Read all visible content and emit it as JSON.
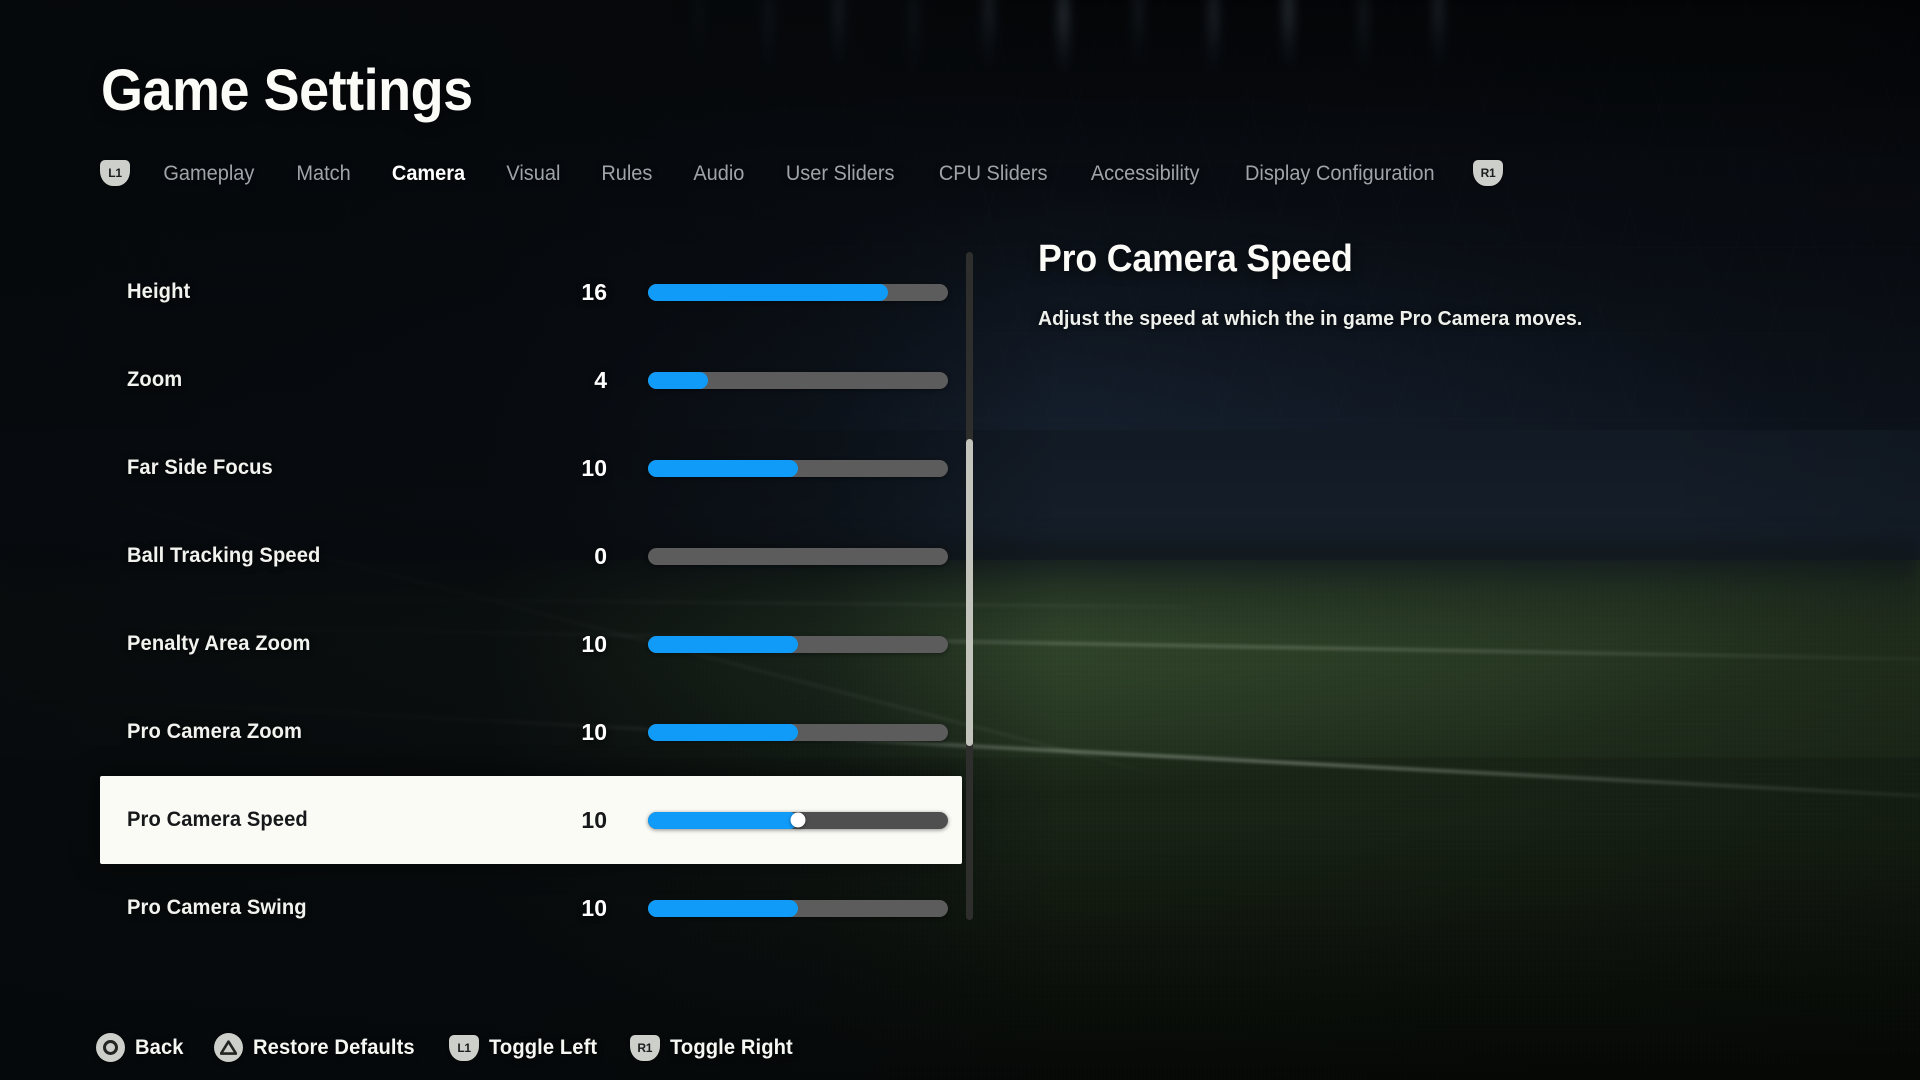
{
  "header": {
    "title": "Game Settings"
  },
  "tabs": {
    "left_bumper": "L1",
    "right_bumper": "R1",
    "items": [
      {
        "label": "Gameplay",
        "active": false
      },
      {
        "label": "Match",
        "active": false
      },
      {
        "label": "Camera",
        "active": true
      },
      {
        "label": "Visual",
        "active": false
      },
      {
        "label": "Rules",
        "active": false
      },
      {
        "label": "Audio",
        "active": false
      },
      {
        "label": "User Sliders",
        "active": false
      },
      {
        "label": "CPU Sliders",
        "active": false
      },
      {
        "label": "Accessibility",
        "active": false
      },
      {
        "label": "Display Configuration",
        "active": false
      }
    ]
  },
  "settings": {
    "slider_max": 20,
    "rows": [
      {
        "label": "Height",
        "value": "16",
        "percent": 80,
        "selected": false
      },
      {
        "label": "Zoom",
        "value": "4",
        "percent": 20,
        "selected": false
      },
      {
        "label": "Far Side Focus",
        "value": "10",
        "percent": 50,
        "selected": false
      },
      {
        "label": "Ball Tracking Speed",
        "value": "0",
        "percent": 0,
        "selected": false
      },
      {
        "label": "Penalty Area Zoom",
        "value": "10",
        "percent": 50,
        "selected": false
      },
      {
        "label": "Pro Camera Zoom",
        "value": "10",
        "percent": 50,
        "selected": false
      },
      {
        "label": "Pro Camera Speed",
        "value": "10",
        "percent": 50,
        "selected": true
      },
      {
        "label": "Pro Camera Swing",
        "value": "10",
        "percent": 50,
        "selected": false
      }
    ]
  },
  "scrollbar": {
    "thumb_top_percent": 28,
    "thumb_height_percent": 46
  },
  "detail": {
    "title": "Pro Camera Speed",
    "description": "Adjust the speed at which the in game Pro Camera moves."
  },
  "actions": [
    {
      "icon": "circle-button-icon",
      "glyph": "circle",
      "label": "Back"
    },
    {
      "icon": "triangle-button-icon",
      "glyph": "triangle",
      "label": "Restore Defaults"
    },
    {
      "icon": "l1-bumper-icon",
      "glyph": "L1",
      "label": "Toggle Left"
    },
    {
      "icon": "r1-bumper-icon",
      "glyph": "R1",
      "label": "Toggle Right"
    }
  ],
  "colors": {
    "accent_blue": "#119bf8",
    "slider_track": "#5b5c5b",
    "selected_row_bg": "#fbfbf6",
    "text_primary": "#fbfbf8",
    "text_muted": "#9ea4a8"
  }
}
